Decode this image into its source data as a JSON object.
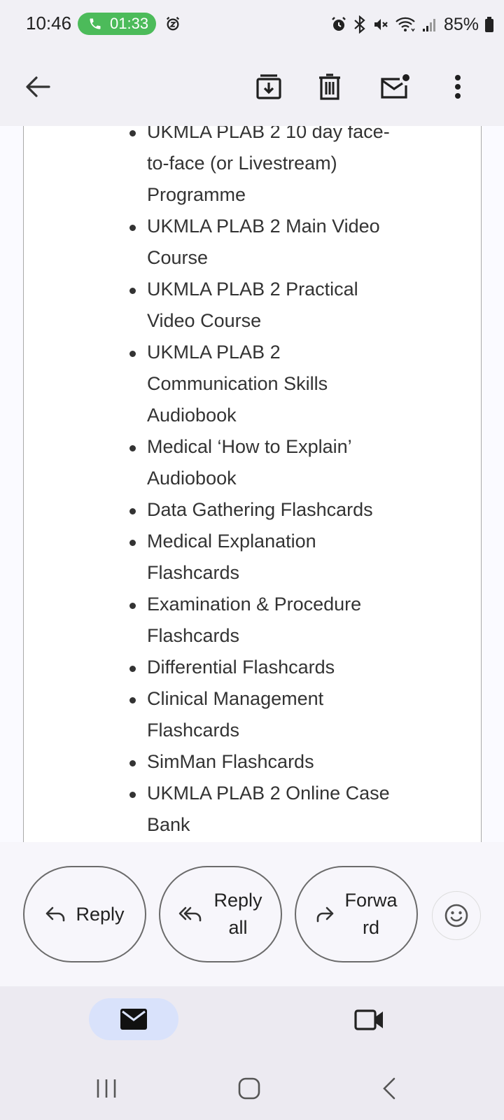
{
  "status_bar": {
    "time": "10:46",
    "call_timer": "01:33",
    "battery": "85%",
    "icons": [
      "phone-icon",
      "alarm-icon",
      "alarm-icon",
      "bluetooth-icon",
      "mute-icon",
      "wifi-icon",
      "signal-icon",
      "battery-icon"
    ]
  },
  "app_bar": {
    "icons": [
      "back-arrow-icon",
      "archive-icon",
      "delete-icon",
      "mark-unread-icon",
      "more-vert-icon"
    ]
  },
  "email": {
    "items": [
      {
        "lines": [
          "UKMLA PLAB 2 10 day face-",
          "to-face (or Livestream)",
          "Programme"
        ]
      },
      {
        "lines": [
          "UKMLA PLAB 2 Main Video",
          "Course"
        ]
      },
      {
        "lines": [
          "UKMLA PLAB 2 Practical",
          "Video Course"
        ]
      },
      {
        "lines": [
          "UKMLA PLAB 2",
          "Communication Skills",
          "Audiobook"
        ]
      },
      {
        "lines": [
          "Medical ‘How to Explain’",
          "Audiobook"
        ]
      },
      {
        "lines": [
          "Data Gathering Flashcards"
        ]
      },
      {
        "lines": [
          "Medical Explanation",
          "Flashcards"
        ]
      },
      {
        "lines": [
          "Examination & Procedure",
          "Flashcards"
        ]
      },
      {
        "lines": [
          "Differential Flashcards"
        ]
      },
      {
        "lines": [
          "Clinical Management",
          "Flashcards"
        ]
      },
      {
        "lines": [
          "SimMan Flashcards"
        ]
      },
      {
        "lines": [
          "UKMLA PLAB 2 Online Case",
          "Bank"
        ]
      }
    ]
  },
  "actions": {
    "reply": "Reply",
    "reply_all_line1": "Reply",
    "reply_all_line2": "all",
    "forward_line1": "Forwa",
    "forward_line2": "rd"
  },
  "bottom_nav": {
    "icons": [
      "mail-icon",
      "video-icon"
    ],
    "mail_active_color": "#d9e2fb"
  },
  "colors": {
    "call_pill": "#4cbb5a",
    "background": "#f1f0f5"
  }
}
